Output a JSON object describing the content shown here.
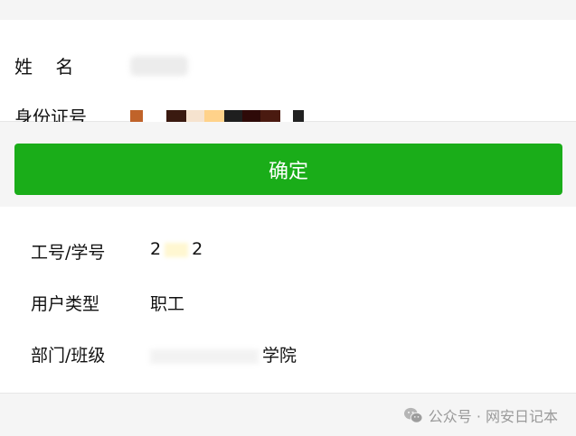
{
  "form": {
    "name_label": "姓    名",
    "id_label": "身份证号",
    "redaction_colors": [
      "#c0632a",
      "#ffffff",
      "#3a1a10",
      "#f6e3cf",
      "#ffd28a",
      "#1f1f1f",
      "#2e0a08",
      "#4a1a10",
      "#ffffff",
      "#222222"
    ]
  },
  "button": {
    "label": "确定",
    "color": "#1aad19"
  },
  "info": {
    "staff_id_label": "工号/学号",
    "staff_id_prefix": "2",
    "staff_id_suffix": "2",
    "user_type_label": "用户类型",
    "user_type_value": "职工",
    "dept_label": "部门/班级",
    "dept_suffix": "学院"
  },
  "footer": {
    "watermark_text": "公众号 · 网安日记本"
  }
}
